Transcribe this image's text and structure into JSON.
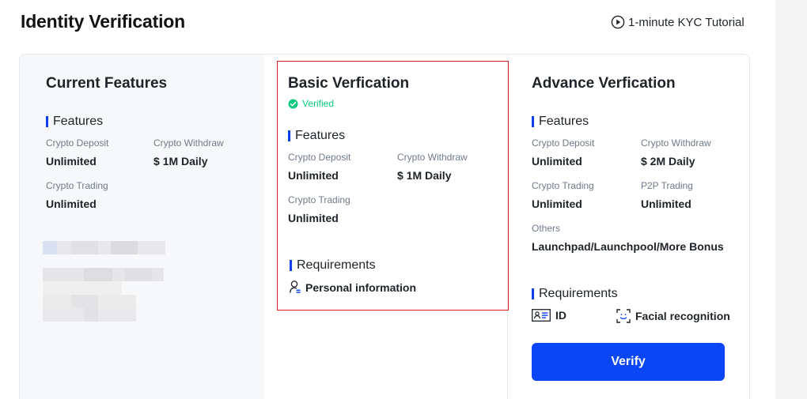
{
  "page": {
    "title": "Identity Verification",
    "tutorial_label": "1-minute KYC Tutorial"
  },
  "current": {
    "title": "Current Features",
    "features_heading": "Features",
    "fields": [
      {
        "label": "Crypto Deposit",
        "value": "Unlimited"
      },
      {
        "label": "Crypto Withdraw",
        "value": "$ 1M Daily"
      },
      {
        "label": "Crypto Trading",
        "value": "Unlimited"
      }
    ]
  },
  "basic": {
    "title": "Basic Verfication",
    "status": "Verified",
    "features_heading": "Features",
    "fields": [
      {
        "label": "Crypto Deposit",
        "value": "Unlimited"
      },
      {
        "label": "Crypto Withdraw",
        "value": "$ 1M Daily"
      },
      {
        "label": "Crypto Trading",
        "value": "Unlimited"
      }
    ],
    "requirements_heading": "Requirements",
    "requirements": [
      "Personal information"
    ]
  },
  "advance": {
    "title": "Advance Verfication",
    "features_heading": "Features",
    "fields": [
      {
        "label": "Crypto Deposit",
        "value": "Unlimited"
      },
      {
        "label": "Crypto Withdraw",
        "value": "$ 2M Daily"
      },
      {
        "label": "Crypto Trading",
        "value": "Unlimited"
      },
      {
        "label": "P2P Trading",
        "value": "Unlimited"
      },
      {
        "label": "Others",
        "value": "Launchpad/Launchpool/More Bonus"
      }
    ],
    "requirements_heading": "Requirements",
    "requirements": [
      "ID",
      "Facial recognition"
    ],
    "verify_label": "Verify"
  },
  "icons": {
    "tutorial": "play-circle-icon",
    "verified": "check-circle-icon",
    "personal_info": "user-info-icon",
    "id_card": "id-card-icon",
    "face": "face-scan-icon"
  },
  "colors": {
    "accent": "#0a46f5",
    "section_bar": "#0a3ff0",
    "verified_green": "#0ecb81",
    "highlight_red": "#e02020",
    "current_bg": "#f7f8fa"
  }
}
